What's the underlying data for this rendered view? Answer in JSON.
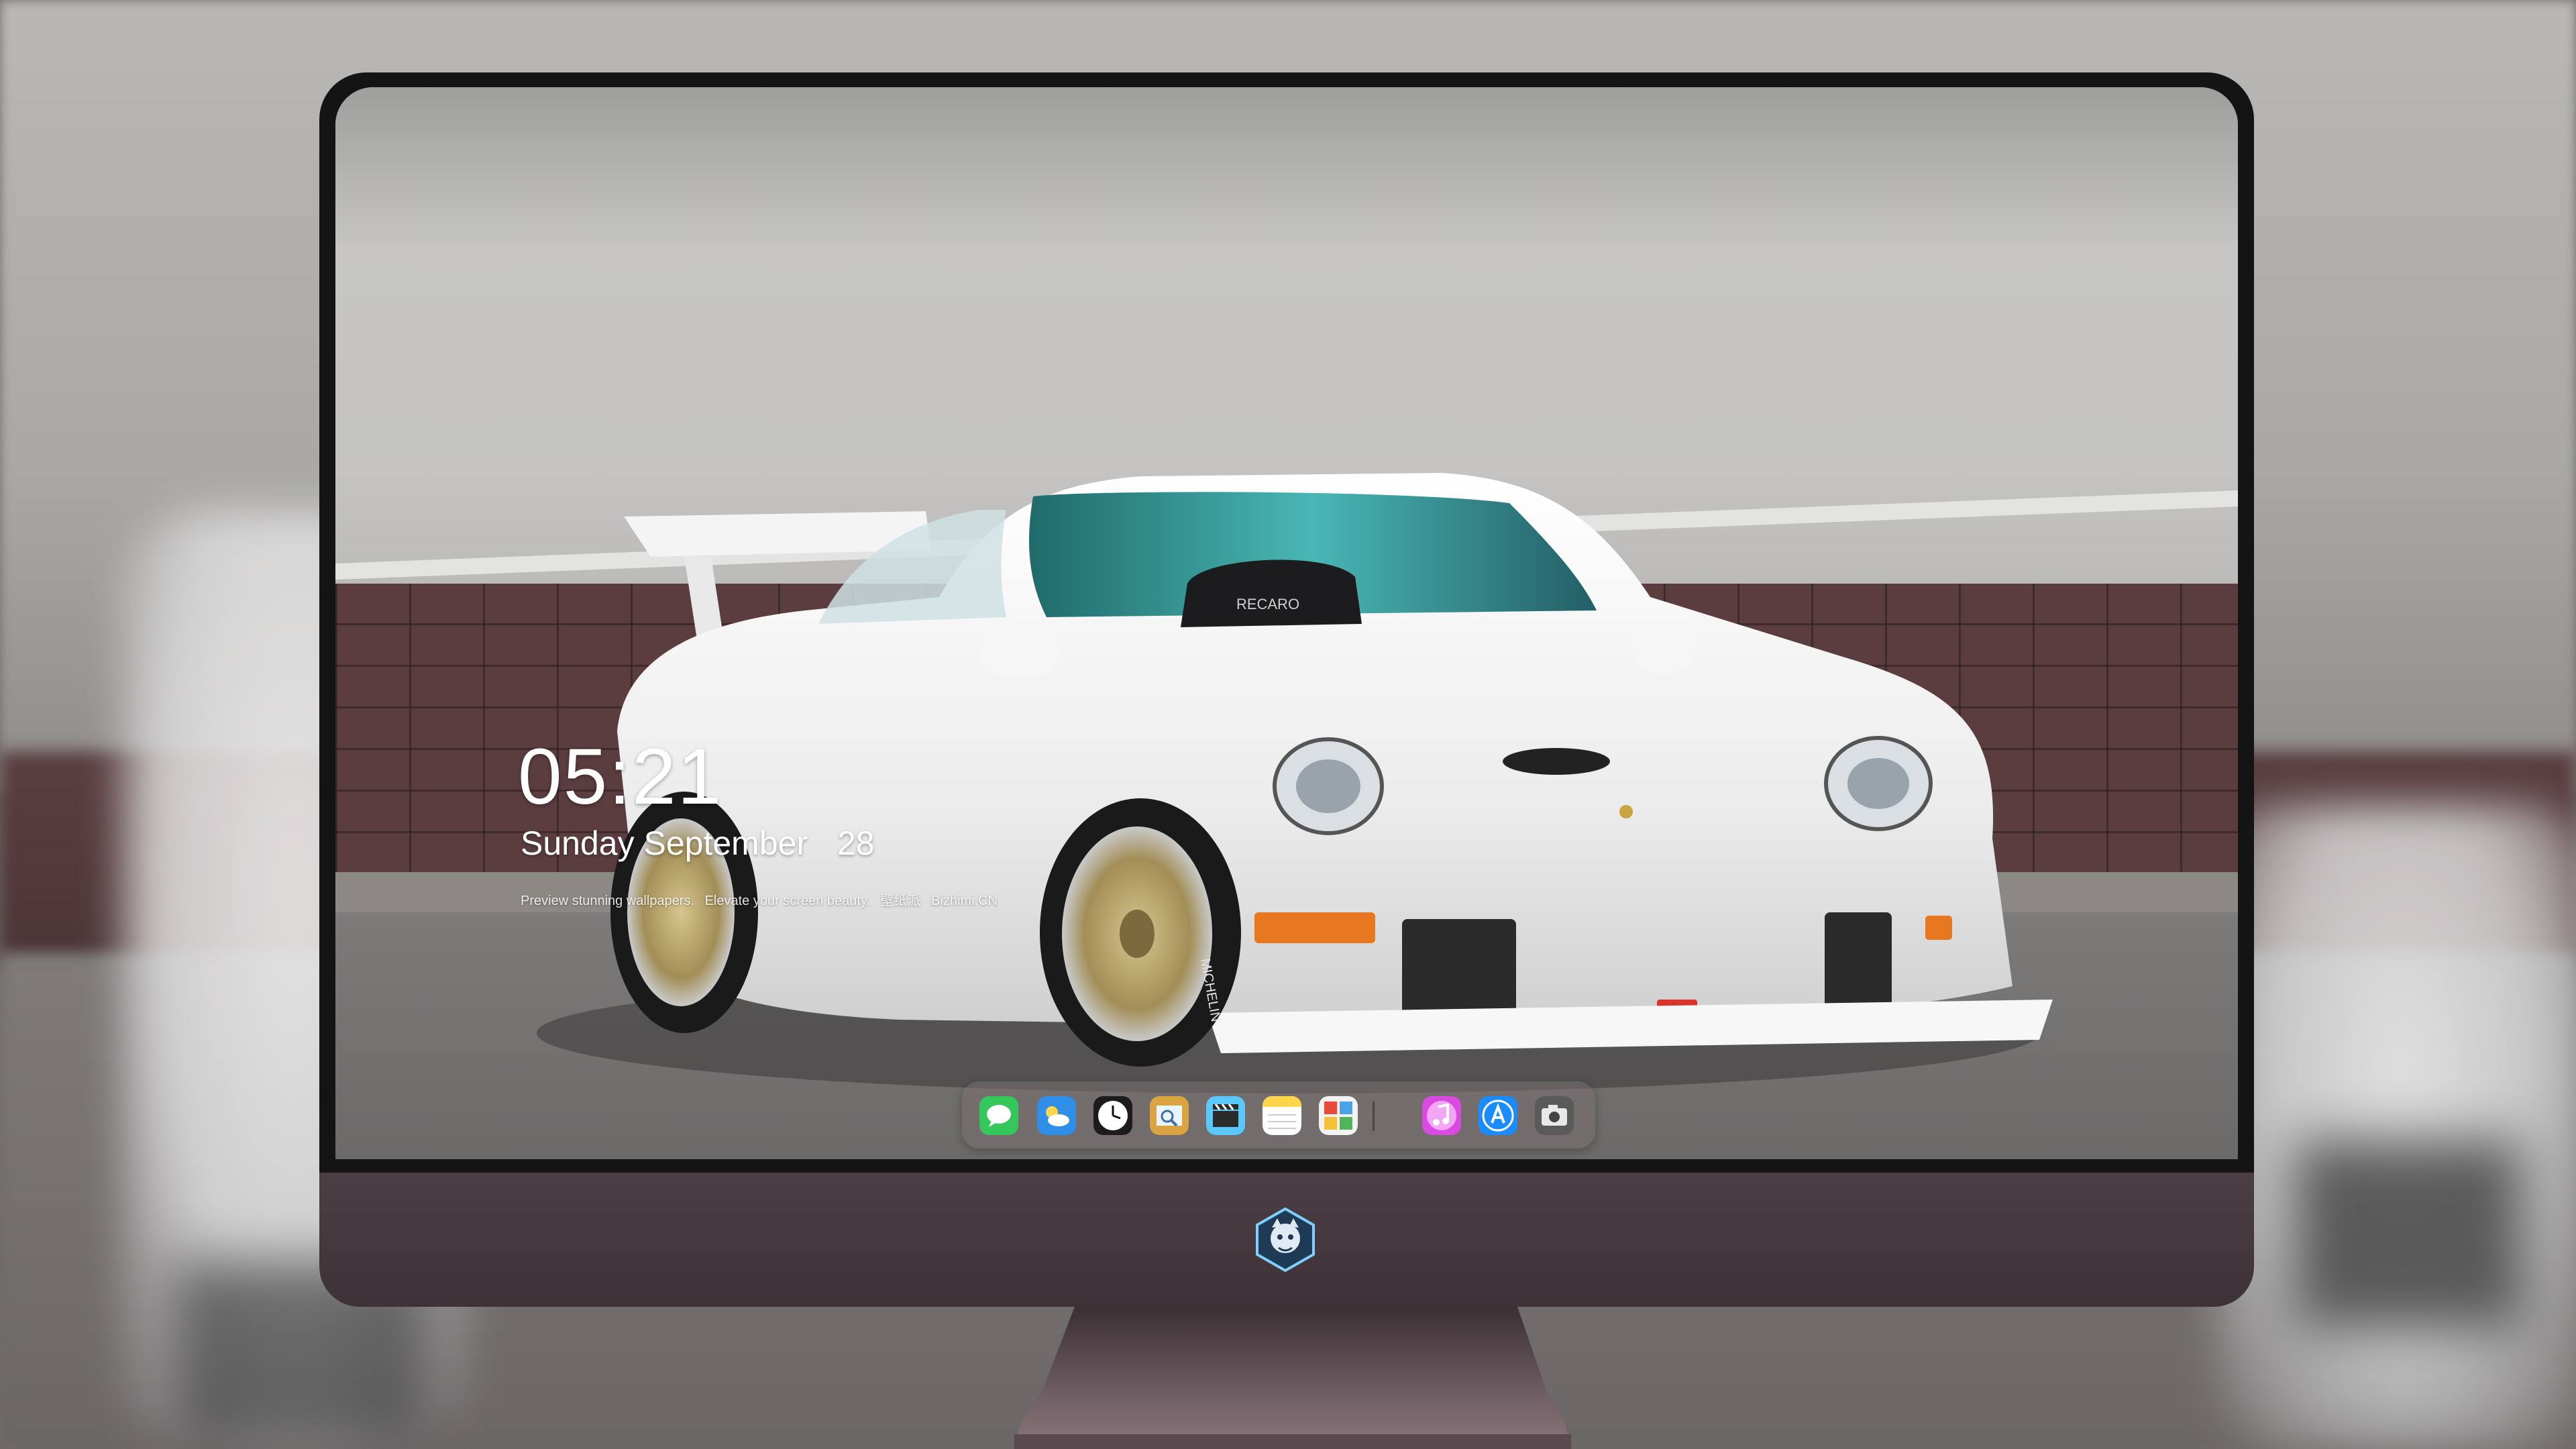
{
  "lock_screen": {
    "time": "05:21",
    "weekday": "Sunday",
    "month": "September",
    "day": "28",
    "tagline": {
      "text_1": "Preview stunning wallpapers.",
      "text_2": "Elevate your screen beauty.",
      "text_3": "壁纸派",
      "text_4": "Bizhimi.CN"
    }
  },
  "wallpaper": {
    "seat_brand": "RECARO",
    "tire_brand": "MICHELIN"
  },
  "dock": {
    "apps": [
      {
        "name": "Messages",
        "icon": "messages-icon",
        "color": "#34c759"
      },
      {
        "name": "Weather",
        "icon": "weather-icon",
        "color": "#2f8ee8"
      },
      {
        "name": "Clock",
        "icon": "clock-icon",
        "color": "#ffffff"
      },
      {
        "name": "Preview",
        "icon": "preview-icon",
        "color": "#d9a441"
      },
      {
        "name": "Final Cut",
        "icon": "clapperboard-icon",
        "color": "#5ac8fa"
      },
      {
        "name": "Notes",
        "icon": "notes-icon",
        "color": "#ffd54a"
      },
      {
        "name": "Photo Booth",
        "icon": "photo-booth-icon",
        "color": "#e84a3c"
      },
      {
        "name": "iTunes",
        "icon": "music-icon",
        "color": "#d94ae0"
      },
      {
        "name": "App Store",
        "icon": "app-store-icon",
        "color": "#1a8cff"
      },
      {
        "name": "Screenshot",
        "icon": "camera-icon",
        "color": "#5a5a5a"
      }
    ]
  },
  "colors": {
    "monitor_bezel": "#141414",
    "monitor_chin": "#3e3238",
    "brick": "#5b3d40",
    "car_body": "#f1f1f1"
  }
}
